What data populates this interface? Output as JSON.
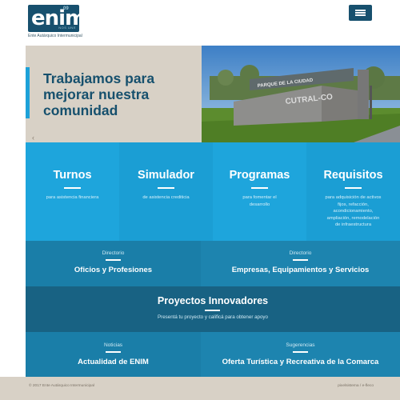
{
  "header": {
    "logo_small": "09",
    "logo_text": "enim",
    "logo_tag": "NOS UNE",
    "logo_subtitle": "Ente Autárquico Intermunicipal",
    "menu_icon": "hamburger-icon"
  },
  "hero": {
    "title": "Trabajamos para mejorar nuestra comunidad",
    "arrow": "‹",
    "sign_line1": "PARQUE DE LA CIUDAD",
    "sign_line2": "CUTRAL-CO"
  },
  "tiles": [
    {
      "title": "Turnos",
      "subtitle": "para asistencia financiera",
      "color": "#1ea5dc"
    },
    {
      "title": "Simulador",
      "subtitle": "de asistencia crediticia",
      "color": "#1b9ed4"
    },
    {
      "title": "Programas",
      "subtitle": "para fomentar el desarrollo",
      "color": "#1ea5dc"
    },
    {
      "title": "Requisitos",
      "subtitle": "para adquisición de activos fijos, refacción, acondicionamiento, ampliación, remodelación de infraestructura",
      "color": "#1b9ed4"
    }
  ],
  "directory": [
    {
      "eyebrow": "Directorio",
      "title": "Oficios y Profesiones",
      "color": "#1a7ea8"
    },
    {
      "eyebrow": "Directorio",
      "title": "Empresas, Equipamientos y Servicios",
      "color": "#1d84af"
    }
  ],
  "projects": {
    "title": "Proyectos Innovadores",
    "subtitle": "Presentá tu proyecto y calificá para obtener apoyo",
    "color": "#186283"
  },
  "news": [
    {
      "eyebrow": "Noticias",
      "title": "Actualidad de ENIM",
      "color": "#1a7ea8"
    },
    {
      "eyebrow": "Sugerencias",
      "title": "Oferta Turística y Recreativa de la Comarca",
      "color": "#1d84af"
    }
  ],
  "footer": {
    "copyright": "© 2017 Ente Autárquico Intermunicipal",
    "credit": "pixelsistema / e-fleco"
  }
}
